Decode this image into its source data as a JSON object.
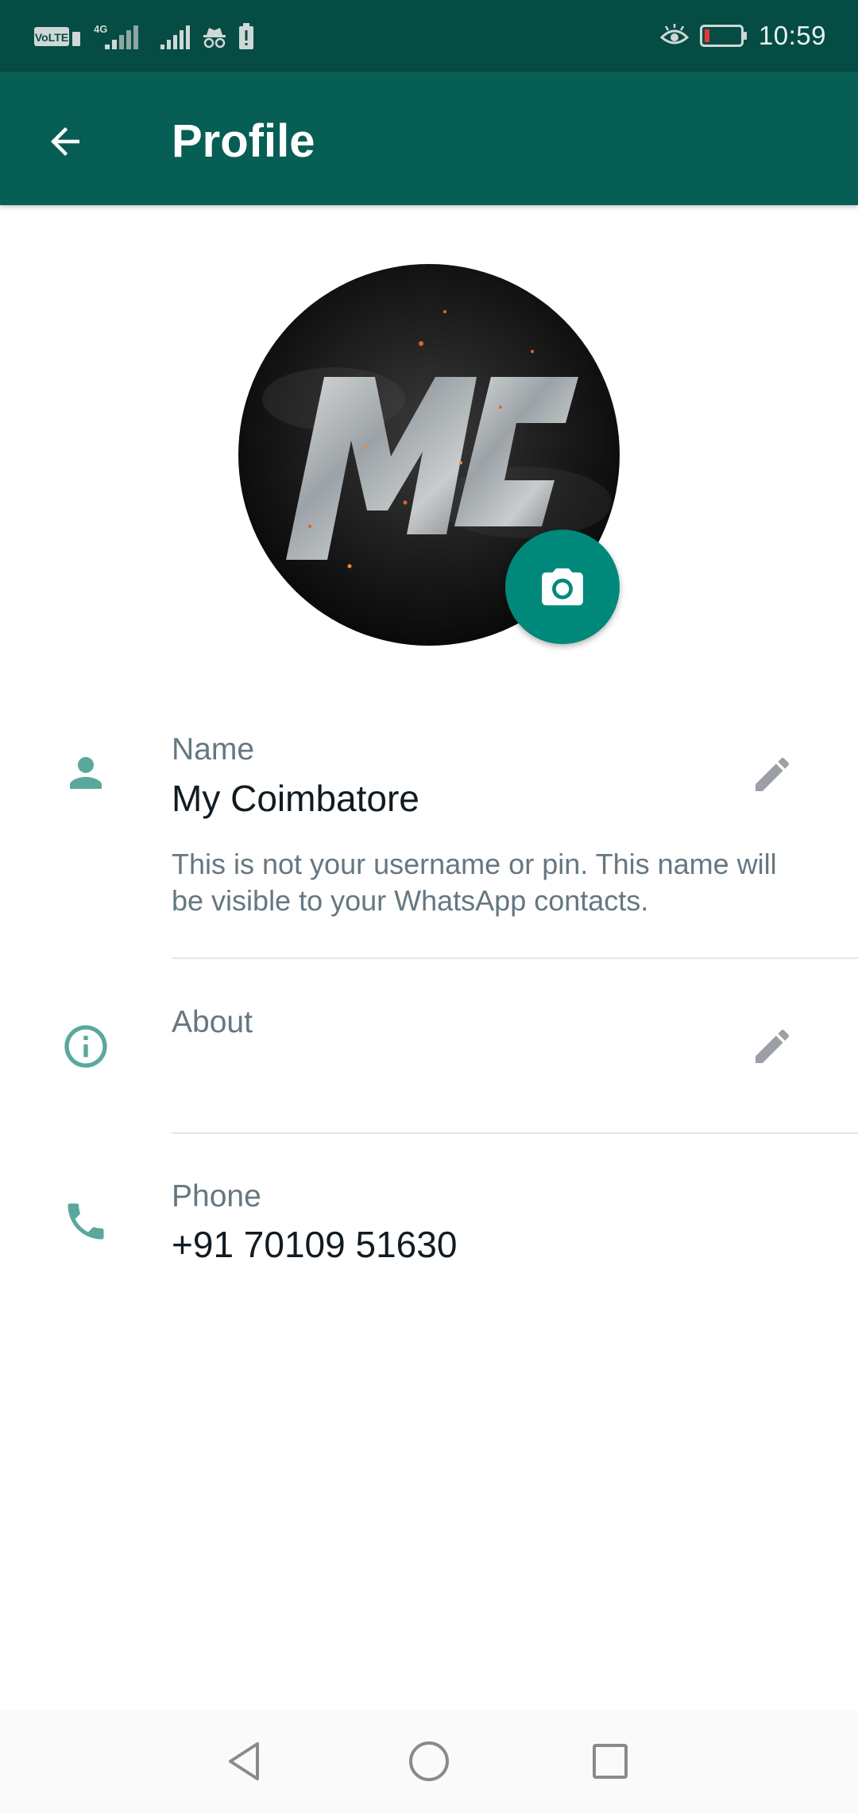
{
  "status_bar": {
    "time": "10:59",
    "left_icons": [
      "volte-icon",
      "4g-signal-icon",
      "signal-icon",
      "incognito-icon",
      "battery-alert-icon"
    ],
    "right_icons": [
      "eye-comfort-icon",
      "battery-low-icon"
    ]
  },
  "app_bar": {
    "title": "Profile"
  },
  "profile_photo": {
    "logo_text": "MC"
  },
  "name": {
    "label": "Name",
    "value": "My Coimbatore",
    "hint": "This is not your username or pin. This name will be visible to your WhatsApp contacts."
  },
  "about": {
    "label": "About",
    "value": ""
  },
  "phone": {
    "label": "Phone",
    "value": "+91 70109 51630"
  },
  "nav_bar": {
    "buttons": [
      "back-triangle",
      "home-circle",
      "recents-square"
    ]
  },
  "colors": {
    "status_bar": "#054c44",
    "app_bar": "#075e54",
    "accent": "#00897b",
    "icon_teal": "#5aa89c"
  }
}
